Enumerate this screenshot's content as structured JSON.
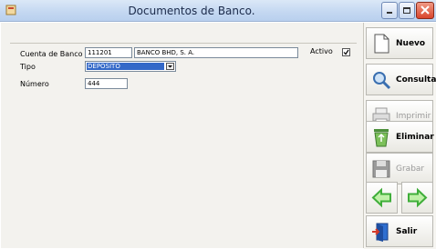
{
  "window": {
    "title": "Documentos de Banco."
  },
  "form": {
    "cuenta_label": "Cuenta de Banco",
    "cuenta_code": "111201",
    "cuenta_name": "BANCO BHD, S. A.",
    "activo_label": "Activo",
    "activo_checked": true,
    "tipo_label": "Tipo",
    "tipo_value": "DEPOSITO",
    "numero_label": "Número",
    "numero_value": "444"
  },
  "toolbar": {
    "nuevo": "Nuevo",
    "consulta": "Consulta",
    "imprimir": "Imprimir",
    "eliminar": "Eliminar",
    "grabar": "Grabar",
    "salir": "Salir"
  },
  "colors": {
    "selection": "#3368c8",
    "nav_arrow": "#3fae3a",
    "disabled_text": "#9a9a9a"
  },
  "icons": [
    "app-icon",
    "minimize-icon",
    "maximize-icon",
    "close-icon",
    "new-document-icon",
    "magnifier-icon",
    "printer-icon",
    "recycle-bin-icon",
    "floppy-disk-icon",
    "arrow-left-icon",
    "arrow-right-icon",
    "exit-door-icon",
    "checkmark-icon",
    "chevron-down-icon"
  ]
}
